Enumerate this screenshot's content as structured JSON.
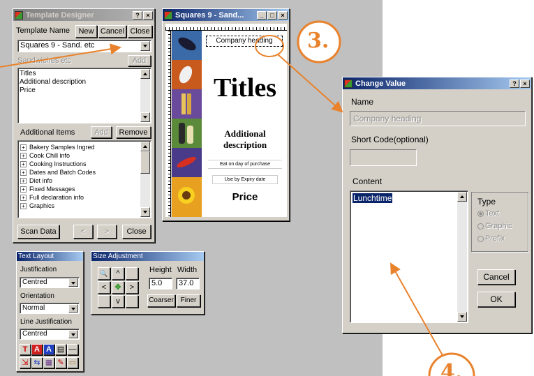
{
  "template_designer": {
    "title": "Template Designer",
    "help_btn": "?",
    "close_btn": "×",
    "template_name_label": "Template Name",
    "new_label": "New",
    "cancel_label": "Cancel",
    "close_label": "Close",
    "template_value": "Squares 9 - Sand. etc",
    "sandwiches_label": "Sandwiches etc",
    "add_label": "Add",
    "fields": [
      "Titles",
      "Additional description",
      "Price"
    ],
    "additional_items_label": "Additional Items",
    "remove_label": "Remove",
    "items": [
      "Bakery Samples Ingred",
      "Cook Chill info",
      "Cooking Instructions",
      "Dates and Batch Codes",
      "Diet info",
      "Fixed Messages",
      "Full declaration info",
      "Graphics"
    ],
    "scan_data_label": "Scan Data",
    "back_label": "<",
    "fwd_label": ">",
    "close2_label": "Close"
  },
  "preview": {
    "title": "Squares 9 - Sand...",
    "min_btn": "_",
    "max_btn": "□",
    "close_btn": "×",
    "company_heading": "Company heading",
    "titles": "Titles",
    "additional_1": "Additional",
    "additional_2": "description",
    "eat_on_day": "Eat on day of purchase",
    "use_by": "Use by Expiry date",
    "price": "Price"
  },
  "text_layout": {
    "title": "Text Layout",
    "justification_label": "Justification",
    "justification_value": "Centred",
    "orientation_label": "Orientation",
    "orientation_value": "Normal",
    "line_justification_label": "Line Justification",
    "line_justification_value": "Centred",
    "tools_row1": [
      "T",
      "A",
      "A",
      "▤",
      "—"
    ],
    "tools_row2": [
      "⇲",
      "⇆",
      "▦",
      "✎",
      "▭"
    ]
  },
  "size_adjustment": {
    "title": "Size Adjustment",
    "height_label": "Height",
    "width_label": "Width",
    "height_value": "5.0",
    "width_value": "37.0",
    "coarser_label": "Coarser",
    "finer_label": "Finer",
    "zoom_glyph": "🔍",
    "up_glyph": "^",
    "left_glyph": "<",
    "right_glyph": ">",
    "down_glyph": "v",
    "center_glyph": "✥"
  },
  "change_value": {
    "title": "Change Value",
    "help_btn": "?",
    "close_btn": "×",
    "name_label": "Name",
    "name_value": "Company heading",
    "short_code_label": "Short Code(optional)",
    "short_code_value": "",
    "content_label": "Content",
    "content_value": "Lunchtime",
    "type_label": "Type",
    "type_options": [
      "Text",
      "Graphic",
      "Prefix"
    ],
    "cancel_label": "Cancel",
    "ok_label": "OK"
  },
  "annotations": {
    "step3": "3.",
    "step4": "4."
  },
  "colors": {
    "annotation": "#e8822c",
    "active_title": "#0a246a",
    "selection": "#0a246a"
  }
}
